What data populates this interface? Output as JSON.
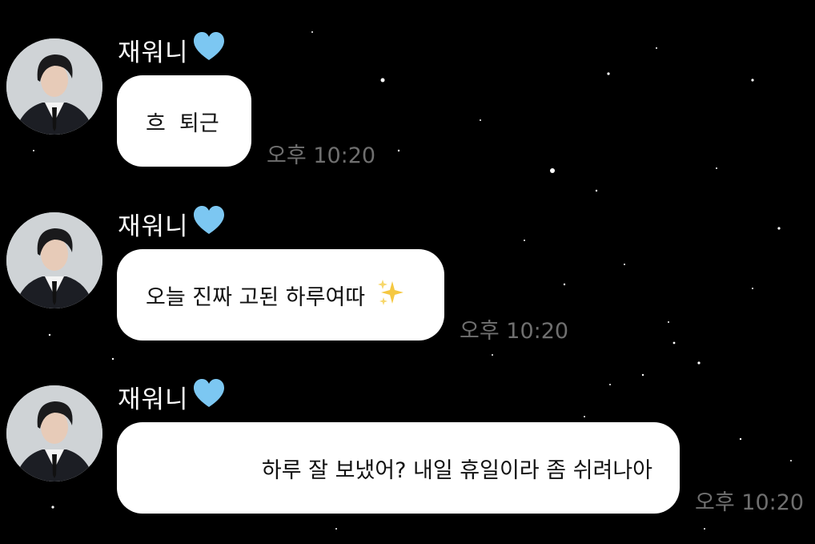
{
  "chat": {
    "messages": [
      {
        "sender": "재워니",
        "text": "흐  퇴근",
        "time": "오후 10:20",
        "emoji": ""
      },
      {
        "sender": "재워니",
        "text": "오늘 진짜 고된 하루여따",
        "time": "오후 10:20",
        "emoji": "sparkles-icon"
      },
      {
        "sender": "재워니",
        "text": "하루 잘 보냈어? 내일 휴일이라 좀 쉬려나아",
        "time": "오후 10:20",
        "emoji": ""
      }
    ]
  },
  "colors": {
    "background": "#000000",
    "bubble": "#ffffff",
    "heart": "#7cc7f2",
    "timestamp": "#6f6f6f"
  }
}
